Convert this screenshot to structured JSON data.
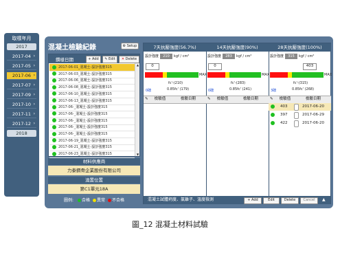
{
  "year_month_panel": {
    "title": "取樣年月",
    "items": [
      {
        "label": "2017",
        "kind": "year"
      },
      {
        "label": "2017-04",
        "kind": "month",
        "arrow": "›"
      },
      {
        "label": "2017-05",
        "kind": "month",
        "arrow": "›"
      },
      {
        "label": "2017-06",
        "kind": "month",
        "arrow": "›",
        "selected": true
      },
      {
        "label": "2017-07",
        "kind": "month",
        "arrow": "›"
      },
      {
        "label": "2017-09",
        "kind": "month",
        "arrow": "›"
      },
      {
        "label": "2017-10",
        "kind": "month",
        "arrow": "›"
      },
      {
        "label": "2017-11",
        "kind": "month",
        "arrow": "›"
      },
      {
        "label": "2017-12",
        "kind": "month",
        "arrow": "›"
      },
      {
        "label": "2018",
        "kind": "year"
      }
    ]
  },
  "record_panel": {
    "title": "混凝土檢驗紀錄",
    "setup_label": "Setup",
    "list_header": "鑽樣日期",
    "add_label": "+ Add",
    "edit_label": "Edit",
    "delete_label": "Delete",
    "rows": [
      "2017-06-01_混凝土-設計強度315",
      "2017-06-03_混凝土-設計強度315",
      "2017-06-06_混凝土-設計強度315",
      "2017-06-08_混凝土-設計強度315",
      "2017-06-10_混凝土-設計強度315",
      "2017-06-13_混凝土-設計強度315",
      "2017-06-_混凝土-設計強度315",
      "2017-06-_混凝土-設計強度315",
      "2017-06-_混凝土-設計強度315",
      "2017-06-_混凝土-設計強度315",
      "2017-06-_混凝土-設計強度315",
      "2017-06-19_混凝土-設計強度315",
      "2017-06-21_混凝土-設計強度315",
      "2017-06-23_混凝土-設計強度315"
    ],
    "supplier_header": "材料供應商",
    "supplier_value": "力泰鋼骨企業股份有限公司",
    "location_header": "澆置位置",
    "location_value": "第C1單元18A",
    "legend": {
      "prefix": "圖例:",
      "items": [
        {
          "label": "合格",
          "color": "#20c020"
        },
        {
          "label": "異常",
          "color": "#f2e000"
        },
        {
          "label": "不合格",
          "color": "#e01010"
        }
      ]
    }
  },
  "strength_columns": [
    {
      "title": "7天抗壓強度(56.7%)",
      "design_label": "設計強度",
      "design_value": "210",
      "unit": "kgf / cm²",
      "sim_value": "0",
      "max_label": "MAX",
      "zero_label": "0磅",
      "fc_label": "fc'-(210)",
      "fc2_label": "0.85fc' (179)",
      "table_headers": [
        "檢驗值",
        "檢驗日期"
      ],
      "samples": []
    },
    {
      "title": "14天抗壓強度(90%)",
      "design_label": "設計強度",
      "design_value": "283",
      "unit": "kgf / cm²",
      "sim_value": "0",
      "max_label": "MAX",
      "zero_label": "0磅",
      "fc_label": "fc'-(283)",
      "fc2_label": "0.85fc' (241)",
      "table_headers": [
        "檢驗值",
        "檢驗日期"
      ],
      "samples": []
    },
    {
      "title": "28天抗壓強度(100%)",
      "design_label": "設計強度",
      "design_value": "315",
      "unit": "kgf / cm²",
      "sim_value": "403",
      "max_label": "MAX",
      "zero_label": "3磅",
      "fc_label": "fc'-(315)",
      "fc2_label": "0.85fc' (268)",
      "table_headers": [
        "檢驗值",
        "檢驗日期"
      ],
      "samples": [
        {
          "value": "403",
          "date": "2017-06-20",
          "status_color": "#20c020"
        },
        {
          "value": "397",
          "date": "2017-06-29",
          "status_color": "#20c020"
        },
        {
          "value": "422",
          "date": "2017-06-20",
          "status_color": "#20c020"
        }
      ]
    }
  ],
  "bottom_bar": {
    "text": "混凝土試體坍度、氯離子、溫度檢測",
    "add_label": "+ Add",
    "edit_label": "Edit",
    "delete_label": "Delete",
    "cancel_label": "Cancel"
  },
  "caption": "圖_12  混凝土材料試驗"
}
